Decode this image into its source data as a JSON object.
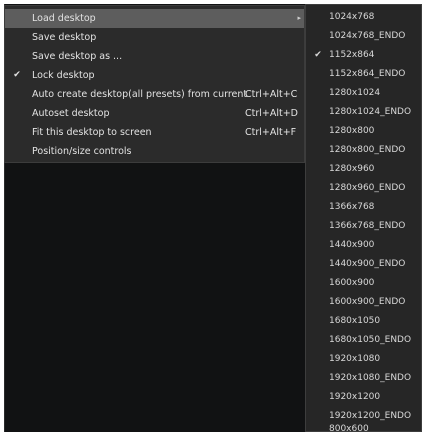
{
  "main_menu": {
    "items": [
      {
        "label": "Load desktop",
        "shortcut": "",
        "checked": false,
        "submenu_arrow": "▸",
        "highlighted": true
      },
      {
        "label": "Save desktop",
        "shortcut": "",
        "checked": false
      },
      {
        "label": "Save desktop as ...",
        "shortcut": "",
        "checked": false
      },
      {
        "label": "Lock desktop",
        "shortcut": "",
        "checked": true,
        "check_glyph": "✔"
      },
      {
        "label": "Auto create desktop(all presets) from current",
        "shortcut": "Ctrl+Alt+C",
        "checked": false
      },
      {
        "label": "Autoset desktop",
        "shortcut": "Ctrl+Alt+D",
        "checked": false
      },
      {
        "label": "Fit this desktop to screen",
        "shortcut": "Ctrl+Alt+F",
        "checked": false
      },
      {
        "label": "Position/size controls",
        "shortcut": "",
        "checked": false
      }
    ]
  },
  "sub_menu": {
    "check_glyph": "✔",
    "items": [
      {
        "label": "1024x768"
      },
      {
        "label": "1024x768_ENDO"
      },
      {
        "label": "1152x864",
        "checked": true
      },
      {
        "label": "1152x864_ENDO"
      },
      {
        "label": "1280x1024"
      },
      {
        "label": "1280x1024_ENDO"
      },
      {
        "label": "1280x800"
      },
      {
        "label": "1280x800_ENDO"
      },
      {
        "label": "1280x960"
      },
      {
        "label": "1280x960_ENDO"
      },
      {
        "label": "1366x768"
      },
      {
        "label": "1366x768_ENDO"
      },
      {
        "label": "1440x900"
      },
      {
        "label": "1440x900_ENDO"
      },
      {
        "label": "1600x900"
      },
      {
        "label": "1600x900_ENDO"
      },
      {
        "label": "1680x1050"
      },
      {
        "label": "1680x1050_ENDO"
      },
      {
        "label": "1920x1080"
      },
      {
        "label": "1920x1080_ENDO"
      },
      {
        "label": "1920x1200"
      },
      {
        "label": "1920x1200_ENDO"
      },
      {
        "label": "800x600"
      }
    ]
  },
  "colors": {
    "menu_bg": "#2b2b2b",
    "submenu_bg": "#262626",
    "highlight": "#5d5d5d",
    "text": "#e3e3e3",
    "background_window": "#111213"
  }
}
